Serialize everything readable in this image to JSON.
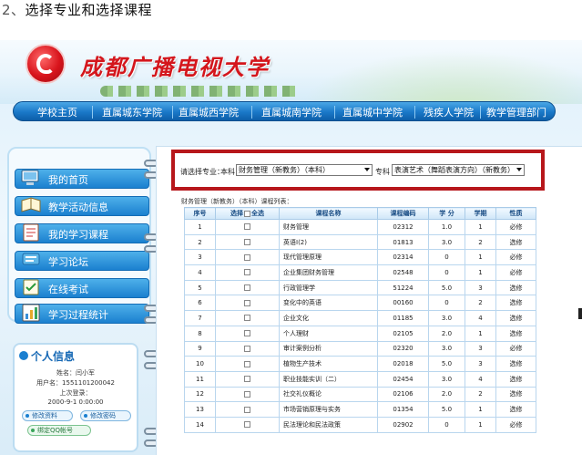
{
  "caption": {
    "number": "2、",
    "text": "选择专业和选择课程"
  },
  "header": {
    "school_name": "成都广播电视大学",
    "logo_icon": "tv-university-logo-icon"
  },
  "nav": {
    "items": [
      "学校主页",
      "直属城东学院",
      "直属城西学院",
      "直属城南学院",
      "直属城中学院",
      "残疾人学院",
      "教学管理部门"
    ]
  },
  "sidebar": {
    "items": [
      {
        "label": "我的首页",
        "icon": "computer-icon"
      },
      {
        "label": "教学活动信息",
        "icon": "book-icon"
      },
      {
        "label": "我的学习课程",
        "icon": "notebook-icon"
      },
      {
        "label": "学习论坛",
        "icon": "forum-icon"
      },
      {
        "label": "在线考试",
        "icon": "exam-icon"
      },
      {
        "label": "学习过程统计",
        "icon": "chart-icon"
      }
    ]
  },
  "personal": {
    "title": "个人信息",
    "name_line": "姓名：闫小军",
    "username_line": "用户名：1551101200042",
    "last_login_label": "上次登录：",
    "last_login_time": "2000-9-1 0:00:00",
    "edit_profile": "修改资料",
    "change_password": "修改密码",
    "bind_qq": "绑定QQ帐号"
  },
  "select": {
    "label": "请选择专业：",
    "benke_label": "本科",
    "benke_value": "财务管理（新教务）（本科）",
    "zhuanke_label": "专科",
    "zhuanke_value": "表演艺术（舞蹈表演方向）（新教务）"
  },
  "list_caption": "财务管理（新教务）（本科）课程列表：",
  "table": {
    "headers": {
      "index": "序号",
      "select": "选择",
      "select_all": "全选",
      "name": "课程名称",
      "code": "课程编码",
      "credit": "学 分",
      "term": "学期",
      "type": "性质"
    },
    "rows": [
      {
        "index": "1",
        "name": "财务管理",
        "code": "02312",
        "credit": "1.0",
        "term": "1",
        "type": "必修"
      },
      {
        "index": "2",
        "name": "英语Ⅰ(2)",
        "code": "01813",
        "credit": "3.0",
        "term": "2",
        "type": "选修"
      },
      {
        "index": "3",
        "name": "现代管理原理",
        "code": "02314",
        "credit": "0",
        "term": "1",
        "type": "必修"
      },
      {
        "index": "4",
        "name": "企业集团财务管理",
        "code": "02548",
        "credit": "0",
        "term": "1",
        "type": "必修"
      },
      {
        "index": "5",
        "name": "行政管理学",
        "code": "51224",
        "credit": "5.0",
        "term": "3",
        "type": "选修"
      },
      {
        "index": "6",
        "name": "变化中的英语",
        "code": "00160",
        "credit": "0",
        "term": "2",
        "type": "选修"
      },
      {
        "index": "7",
        "name": "企业文化",
        "code": "01185",
        "credit": "3.0",
        "term": "4",
        "type": "选修"
      },
      {
        "index": "8",
        "name": "个人理财",
        "code": "02105",
        "credit": "2.0",
        "term": "1",
        "type": "选修"
      },
      {
        "index": "9",
        "name": "审计案例分析",
        "code": "02320",
        "credit": "3.0",
        "term": "3",
        "type": "必修"
      },
      {
        "index": "10",
        "name": "植物生产技术",
        "code": "02018",
        "credit": "5.0",
        "term": "3",
        "type": "选修"
      },
      {
        "index": "11",
        "name": "职业技能实训（二）",
        "code": "02454",
        "credit": "3.0",
        "term": "4",
        "type": "选修"
      },
      {
        "index": "12",
        "name": "社交礼仪概论",
        "code": "02106",
        "credit": "2.0",
        "term": "2",
        "type": "选修"
      },
      {
        "index": "13",
        "name": "市场营销原理与实务",
        "code": "01354",
        "credit": "5.0",
        "term": "1",
        "type": "选修"
      },
      {
        "index": "14",
        "name": "民法理论和民法政策",
        "code": "02902",
        "credit": "0",
        "term": "1",
        "type": "必修"
      }
    ]
  }
}
